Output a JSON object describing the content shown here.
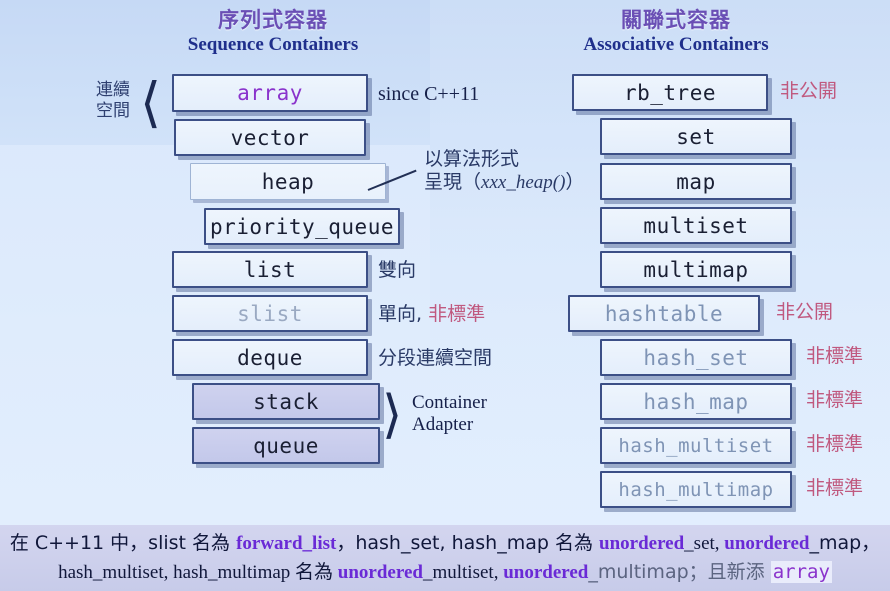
{
  "titles": {
    "left": {
      "zh": "序列式容器",
      "en": "Sequence Containers"
    },
    "right": {
      "zh": "關聯式容器",
      "en": "Associative Containers"
    }
  },
  "side_labels": {
    "contiguous": "連續\n空間",
    "contiguous_line1": "連續",
    "contiguous_line2": "空間",
    "adapter_line1": "Container",
    "adapter_line2": "Adapter"
  },
  "sequence_containers": [
    {
      "name": "array",
      "note": "since C++11",
      "style": "purple-text"
    },
    {
      "name": "vector",
      "note": "",
      "style": ""
    },
    {
      "name": "heap",
      "note": "",
      "style": "thin"
    },
    {
      "name": "priority_queue",
      "note": "",
      "style": ""
    },
    {
      "name": "list",
      "note": "雙向",
      "style": ""
    },
    {
      "name": "slist",
      "note": "單向, 非標準",
      "style": "grey-text"
    },
    {
      "name": "deque",
      "note": "分段連續空間",
      "style": ""
    },
    {
      "name": "stack",
      "note": "",
      "style": "adapter"
    },
    {
      "name": "queue",
      "note": "",
      "style": "adapter"
    }
  ],
  "associative_containers": [
    {
      "name": "rb_tree",
      "note": "非公開",
      "style": ""
    },
    {
      "name": "set",
      "note": "",
      "style": ""
    },
    {
      "name": "map",
      "note": "",
      "style": ""
    },
    {
      "name": "multiset",
      "note": "",
      "style": ""
    },
    {
      "name": "multimap",
      "note": "",
      "style": ""
    },
    {
      "name": "hashtable",
      "note": "非公開",
      "style": "blue-grey-text"
    },
    {
      "name": "hash_set",
      "note": "非標準",
      "style": "blue-grey-text"
    },
    {
      "name": "hash_map",
      "note": "非標準",
      "style": "blue-grey-text"
    },
    {
      "name": "hash_multiset",
      "note": "非標準",
      "style": "blue-grey-text"
    },
    {
      "name": "hash_multimap",
      "note": "非標準",
      "style": "blue-grey-text"
    }
  ],
  "notes": {
    "since_cpp11": "since C++11",
    "heap_note_line1": "以算法形式",
    "heap_note_line2_pre": "呈現（",
    "heap_note_line2_italic": "xxx_heap()",
    "heap_note_line2_post": "）",
    "list_note": "雙向",
    "slist_note_plain": "單向, ",
    "slist_note_red": "非標準",
    "deque_note": "分段連續空間",
    "non_public": "非公開",
    "non_standard": "非標準"
  },
  "footer": {
    "line1": {
      "p1": "在 C++11 中，slist 名為 ",
      "b1": "forward_list",
      "p2": "，hash_set, hash_map 名為 ",
      "b2": "unordered",
      "p3": "_set, ",
      "b3": "unordered",
      "p4": "_map，"
    },
    "line2": {
      "p1": "hash_multiset, hash_multimap 名為 ",
      "b1": "unordered",
      "p2": "_multiset, ",
      "b2": "unordered",
      "p3": "_multimap；且新添 ",
      "mono": "array"
    }
  },
  "colors": {
    "title_zh": "#6a4fb5",
    "title_en": "#1f2f8c",
    "box_border": "#3c4f86",
    "array_text": "#8a33cc",
    "grey_text": "#9aa9c2",
    "blue_grey_text": "#7f94b5",
    "red_note": "#c0597f",
    "footer_bold": "#6a2ad6",
    "background": "#d9e8fb"
  }
}
